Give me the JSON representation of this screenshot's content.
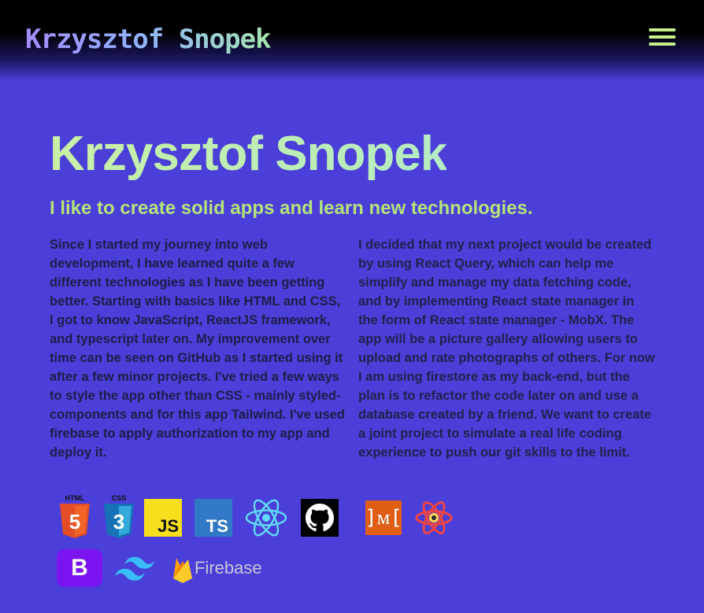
{
  "header": {
    "brand": "Krzysztof Snopek",
    "menu_icon": "hamburger-menu-icon"
  },
  "hero": {
    "title": "Krzysztof Snopek",
    "subtitle": "I like to create solid apps and learn new technologies."
  },
  "about": {
    "left_paragraph": "Since I started my journey into web development, I have learned quite a few different technologies as I have been getting better. Starting with basics like HTML and CSS, I got to know JavaScript, ReactJS framework, and typescript later on. My improvement over time can be seen on GitHub as I started using it after a few minor projects. I've tried a few ways to style the app other than CSS - mainly styled-components and for this app Tailwind. I've used firebase to apply authorization to my app and deploy it.",
    "right_paragraph": "I decided that my next project would be created by using React Query, which can help me simplify and manage my data fetching code, and by implementing React state manager in the form of React state manager - MobX. The app will be a picture gallery allowing users to upload and rate photographs of others. For now I am using firestore as my back-end, but the plan is to refactor the code later on and use a database created by a friend. We want to create a joint project to simulate a real life coding experience to push our git skills to the limit."
  },
  "tech_icons": {
    "html_label": "HTML",
    "html_number": "5",
    "css_label": "CSS",
    "css_number": "3",
    "js_label": "JS",
    "ts_label": "TS",
    "mobx_label": "]ᴍ[",
    "bootstrap_label": "B",
    "firebase_label": "Firebase",
    "icons": [
      "html5-icon",
      "css3-icon",
      "javascript-icon",
      "typescript-icon",
      "react-icon",
      "github-icon",
      "mobx-icon",
      "react-query-icon",
      "bootstrap-icon",
      "tailwind-icon",
      "firebase-icon"
    ]
  },
  "colors": {
    "background": "#4a3fd8",
    "accent_green": "#b6e37a",
    "body_text": "#1f1d48"
  }
}
